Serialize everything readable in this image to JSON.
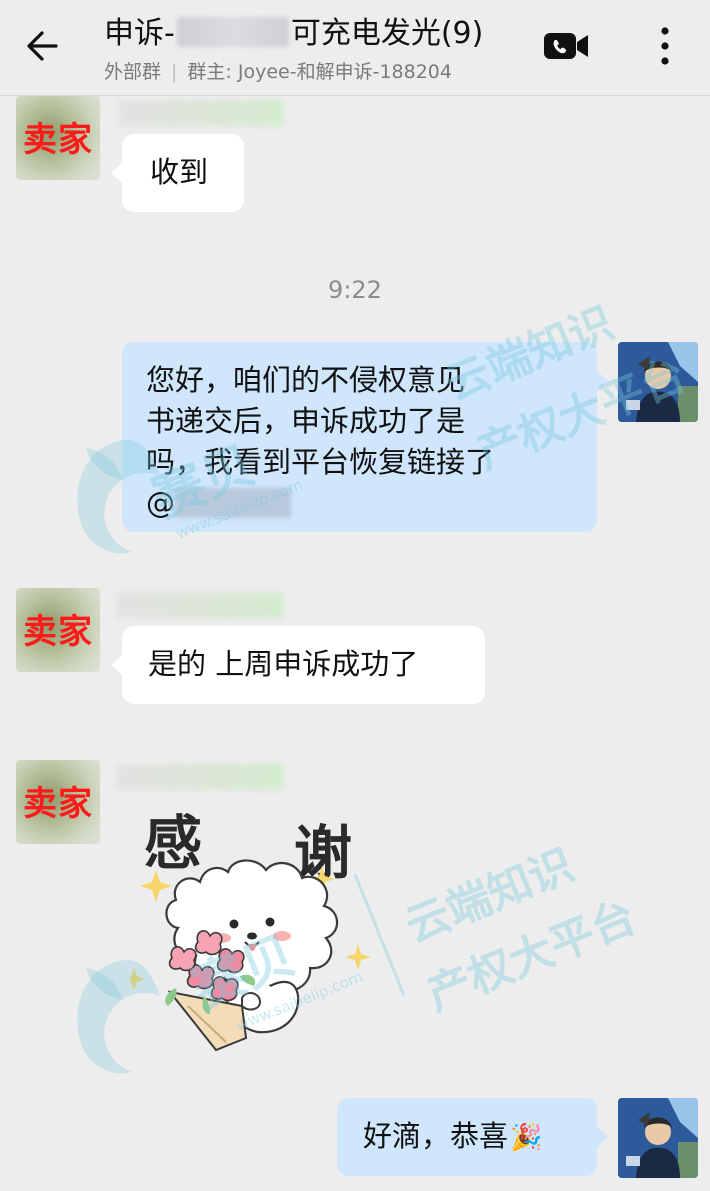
{
  "header": {
    "title_prefix": "申诉-",
    "title_suffix": "可充电发光(9)",
    "group_type": "外部群",
    "owner_prefix": "群主: ",
    "owner": "Joyee-和解申诉-188204",
    "back_icon": "arrow-left-icon",
    "video_icon": "video-call-icon",
    "more_icon": "more-vertical-icon"
  },
  "messages": {
    "m1_text": "收到",
    "m1_avatar_label": "卖家",
    "time": "9:22",
    "m2_line1": "您好，咱们的不侵权意见",
    "m2_line2": "书递交后，申诉成功了是",
    "m2_line3": "吗，我看到平台恢复链接了",
    "m2_at": "@",
    "m3_text": "是的 上周申诉成功了",
    "m3_avatar_label": "卖家",
    "m4_avatar_label": "卖家",
    "sticker_word1": "感",
    "sticker_word2": "谢",
    "m5_text": "好滴，恭喜",
    "m5_emoji": "🎉"
  },
  "watermark": {
    "line1": "云端知识",
    "line2": "产权大平台",
    "brand": "赛贝",
    "url": "www.saibeiip.com"
  },
  "colors": {
    "background": "#ededed",
    "bubble_in": "#ffffff",
    "bubble_out": "#cfe6fc",
    "seller_label": "#ff1a1a"
  }
}
